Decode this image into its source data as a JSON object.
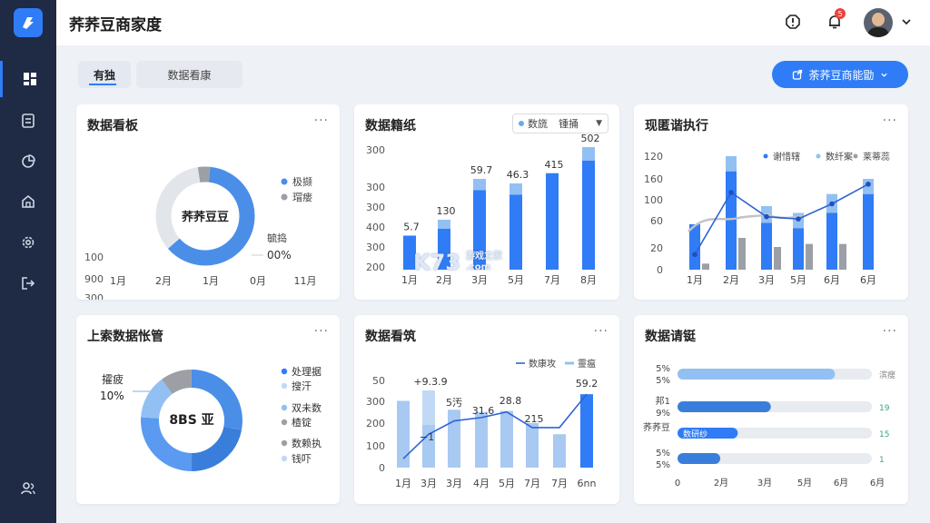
{
  "app": {
    "title": "荞荞豆商家度",
    "logo_icon": "app-logo-icon"
  },
  "sidebar": {
    "items": [
      {
        "icon": "dashboard-icon",
        "active": true
      },
      {
        "icon": "document-icon",
        "active": false
      },
      {
        "icon": "pie-chart-icon",
        "active": false
      },
      {
        "icon": "home-icon",
        "active": false
      },
      {
        "icon": "settings-icon",
        "active": false
      },
      {
        "icon": "export-icon",
        "active": false
      },
      {
        "icon": "users-icon",
        "active": false
      }
    ]
  },
  "header": {
    "notification_count": "5"
  },
  "tabs": [
    {
      "label": "有独"
    },
    {
      "label": "数据看康"
    }
  ],
  "primary_button": {
    "label": "荼荞豆商能勖"
  },
  "cards": {
    "c1": {
      "title": "数据看板"
    },
    "c2": {
      "title": "数据籍纸",
      "select_value_1": "数旒",
      "select_value_2": "锺捅"
    },
    "c3": {
      "title": "现匿谐执行"
    },
    "c4": {
      "title": "上索数据怅管"
    },
    "c5": {
      "title": "数据看筑"
    },
    "c6": {
      "title": "数据请铤"
    }
  },
  "watermark": {
    "big": "K73",
    "small_1": "游戏之家",
    "small_2": ".com"
  },
  "colors": {
    "primary": "#2f7cf6",
    "light": "#93c0f2",
    "pale": "#c2d9f5",
    "gray": "#9c9fa6",
    "sidebar": "#1f2a44"
  },
  "chart_data": [
    {
      "type": "pie",
      "title": "数据看板",
      "center_label": "荞荞豆豆",
      "ylabels": [
        "100",
        "900",
        "300",
        "400",
        "300",
        "200"
      ],
      "xlabels": [
        "1月",
        "2月",
        "1月",
        "0月",
        "11月"
      ],
      "legend": [
        "极撷",
        "瑁瘘"
      ],
      "side_label": "毓捣",
      "side_value": "00%",
      "slices": [
        {
          "value": 62,
          "color": "#4a8ee8"
        },
        {
          "value": 34,
          "color": "#e2e5ea"
        },
        {
          "value": 4,
          "color": "#9c9fa6"
        }
      ]
    },
    {
      "type": "bar",
      "title": "数据籍纸",
      "categories": [
        "1月",
        "2月",
        "3月",
        "5月",
        "7月",
        "8月"
      ],
      "values": [
        150,
        180,
        350,
        330,
        425,
        480
      ],
      "caps": [
        0,
        40,
        50,
        50,
        0,
        60
      ],
      "data_labels": [
        "5.7",
        "130",
        "59.7",
        "46.3",
        "415",
        "502"
      ],
      "ylabels": [
        "300",
        "300",
        "300",
        "400",
        "300",
        "200",
        "100",
        "0"
      ],
      "ylim": [
        0,
        500
      ]
    },
    {
      "type": "bar",
      "title": "现匿谐执行",
      "categories": [
        "1月",
        "2月",
        "3月",
        "5月",
        "6月",
        "6月"
      ],
      "series": [
        {
          "values": [
            60,
            130,
            62,
            55,
            75,
            100
          ],
          "color": "#2f7cf6"
        },
        {
          "values": [
            0,
            20,
            22,
            20,
            25,
            20
          ],
          "color": "#93c0f2"
        },
        {
          "values": [
            8,
            42,
            30,
            34,
            34,
            0
          ],
          "color": "#9c9fa6"
        }
      ],
      "line": [
        20,
        102,
        70,
        67,
        87,
        113
      ],
      "legend": [
        "谢惜辖",
        "数纤案",
        "莱蒂蕊"
      ],
      "ylabels": [
        "120",
        "160",
        "100",
        "60",
        "20",
        "0"
      ],
      "ylim": [
        0,
        150
      ]
    },
    {
      "type": "pie",
      "title": "上索数据怅管",
      "center_label": "8BS 亚",
      "side_label": "攉疲",
      "side_value": "10%",
      "legend": [
        "处理据",
        "搜汗",
        "双未数",
        "楂锭",
        "数赖执",
        "钱吓"
      ],
      "slices": [
        {
          "value": 28,
          "color": "#4a8ee8"
        },
        {
          "value": 22,
          "color": "#3a7edc"
        },
        {
          "value": 26,
          "color": "#5a9af0"
        },
        {
          "value": 14,
          "color": "#93c0f2"
        },
        {
          "value": 10,
          "color": "#9c9fa6"
        }
      ]
    },
    {
      "type": "bar",
      "title": "数据看筑",
      "categories": [
        "1月",
        "3月",
        "3月",
        "4月",
        "5月",
        "7月",
        "7月",
        "6nn"
      ],
      "values": [
        300,
        310,
        260,
        250,
        255,
        200,
        150,
        330
      ],
      "line": [
        40,
        150,
        210,
        225,
        250,
        180,
        180,
        330
      ],
      "data_labels": [
        "+9.3.9",
        "5汚",
        "31.6",
        "28.8",
        "215",
        "59.2"
      ],
      "legend": [
        "数康攻",
        "靈瘟"
      ],
      "ylabels": [
        "50",
        "300",
        "200",
        "100",
        "0"
      ],
      "ylim": [
        0,
        400
      ]
    },
    {
      "type": "bar",
      "title": "数据请铤",
      "orientation": "horizontal",
      "rows": [
        {
          "labels": [
            "5%",
            "5%"
          ],
          "value": 0.81,
          "right_label": "滨瘦",
          "color": "#93c0f2"
        },
        {
          "labels": [
            "邦1",
            "9%"
          ],
          "value": 0.48,
          "right_label": "19",
          "color": "#3a7edc"
        },
        {
          "labels": [
            "荞荞豆",
            ""
          ],
          "value": 0.31,
          "right_label": "15",
          "color": "#2f7cf6",
          "inline_label": "数研纱"
        },
        {
          "labels": [
            "5%",
            "5%"
          ],
          "value": 0.22,
          "right_label": "1",
          "color": "#3a7edc"
        }
      ],
      "xlabels": [
        "0",
        "2月",
        "3月",
        "3月",
        "5月",
        "6月",
        "6月"
      ]
    }
  ]
}
